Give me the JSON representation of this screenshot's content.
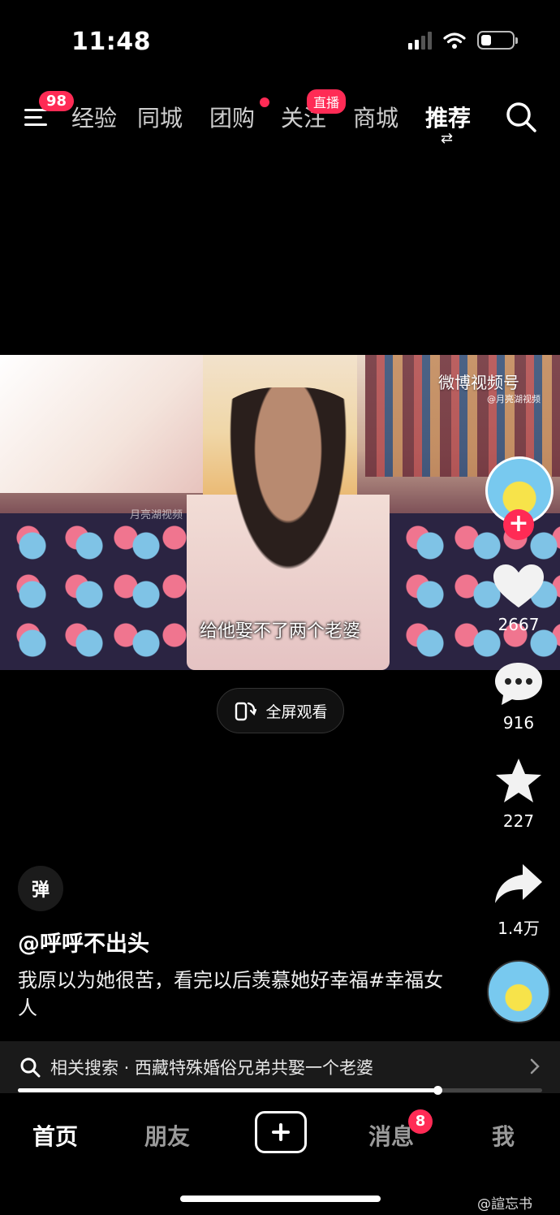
{
  "status_bar": {
    "time": "11:48"
  },
  "top_nav": {
    "menu_badge": "98",
    "tabs": [
      {
        "label": "经验"
      },
      {
        "label": "同城"
      },
      {
        "label": "团购"
      },
      {
        "label": "关注"
      },
      {
        "label": "商城"
      },
      {
        "label": "推荐"
      }
    ],
    "live_badge": "直播"
  },
  "video": {
    "watermark": "微博视频号",
    "watermark_sub": "@月亮湖视频",
    "inner_watermark": "月亮湖视频",
    "subtitle": "给他娶不了两个老婆"
  },
  "fullscreen": {
    "label": "全屏观看"
  },
  "rail": {
    "likes": "2667",
    "comments": "916",
    "favorites": "227",
    "shares": "1.4万"
  },
  "post": {
    "danmu_label": "弹",
    "author": "@呼呼不出头",
    "caption": "我原以为她很苦，看完以后羡慕她好幸福#幸福女人"
  },
  "related_search": {
    "text": "相关搜索 · 西藏特殊婚俗兄弟共娶一个老婆"
  },
  "progress": {
    "fraction": 0.8
  },
  "bottom_nav": {
    "items": [
      {
        "label": "首页"
      },
      {
        "label": "朋友"
      },
      {
        "label": "消息"
      },
      {
        "label": "我"
      }
    ],
    "messages_badge": "8"
  },
  "watermark": "@諠忘书",
  "colors": {
    "accent": "#ff2b55",
    "background": "#000000"
  }
}
